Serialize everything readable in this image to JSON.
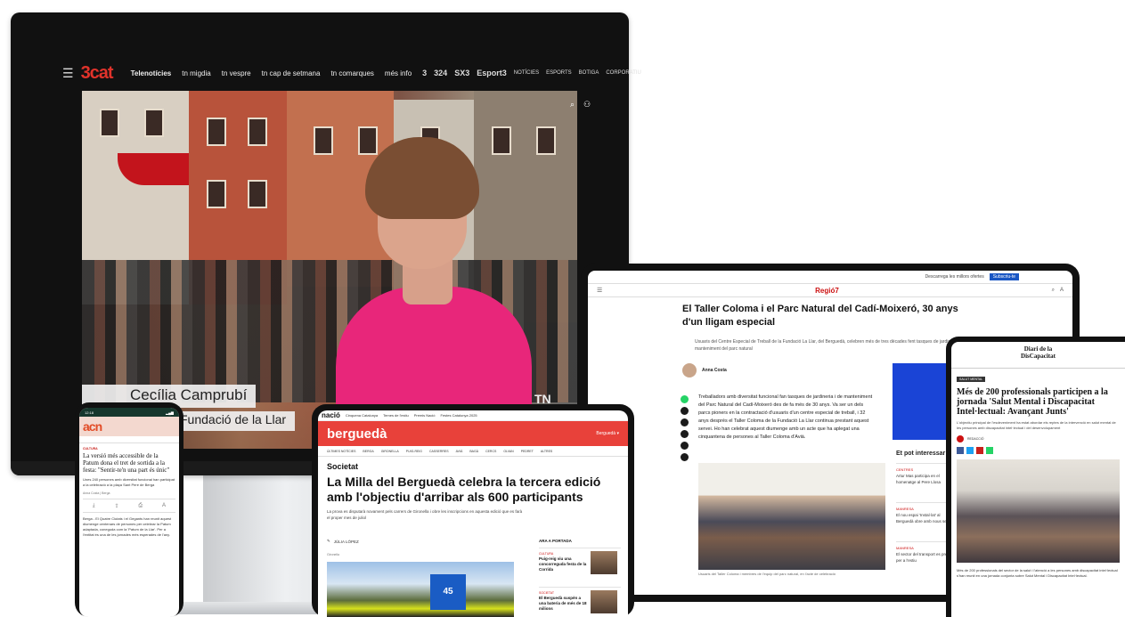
{
  "monitor": {
    "nav": {
      "logo": "3cat",
      "items": [
        "Telenotícies",
        "tn migdia",
        "tn vespre",
        "tn cap de setmana",
        "tn comarques",
        "més info"
      ],
      "right_channels": [
        "3",
        "324",
        "SX3",
        "Esport3"
      ],
      "right_links": [
        "NOTÍCIES",
        "ESPORTS",
        "BOTIGA",
        "CORPORATIU"
      ]
    },
    "video": {
      "name": "Cecília Camprubí",
      "org": "Fundació de la Llar",
      "bug": "TN"
    }
  },
  "regio7": {
    "topbar_text": "Descarrega les millors ofertes",
    "subscribe": "Subscriu-te",
    "logo": "Regió7",
    "title": "El Taller Coloma i el Parc Natural del Cadí-Moixeró, 30 anys d'un lligam especial",
    "lead": "Usuaris del Centre Especial de Treball de la Fundació La Llar, del Berguedà, celebren més de tres dècades fent tasques de jardineria i manteniment del parc natural",
    "author": "Anna Costa",
    "body": "Treballadors amb diversitat funcional fan tasques de jardineria i de manteniment del Parc Natural del Cadí-Moixeró des de fa més de 30 anys. Va ser un dels parcs pioners en la contractació d'usuaris d'un centre especial de treball, i 32 anys després el Taller Coloma de la Fundació La Llar continua prestant aquest servei. Ho han celebrat aquest diumenge amb un acte que ha aplegat una cinquantena de persones al Taller Coloma d'Avià.",
    "caption": "Usuaris del Taller Coloma i membres de l'equip del parc natural, en l'acte de celebració",
    "side_title": "Et pot interessar",
    "side_items": [
      {
        "tag": "CENTRES",
        "text": "Artur Mas participa en el homenatge al Pere Llosa"
      },
      {
        "tag": "MANRESA",
        "text": "El nou espai 'Instal·lat' al Berguedà obre amb nous serveis"
      },
      {
        "tag": "MANRESA",
        "text": "El sector del transport es prepara per a l'estiu"
      }
    ]
  },
  "diari": {
    "logo_line1": "Diari de la",
    "logo_line2": "DisCapacitat",
    "tag": "SALUT MENTAL",
    "title": "Més de 200 professionals participen a la jornada 'Salut Mental i Discapacitat Intel·lectual: Avançant Junts'",
    "lead": "L'objectiu principal de l'esdeveniment ha estat abordar els reptes de la intervenció en salut mental de les persones amb discapacitat intel·lectual i del desenvolupament",
    "author": "REDACCIÓ",
    "body": "Més de 200 professionals del sector de la salut i l'atenció a les persones amb discapacitat intel·lectual s'han reunit en una jornada conjunta sobre Salut Mental i Discapacitat Intel·lectual."
  },
  "acn": {
    "time": "12:18",
    "logo": "acn",
    "section": "CULTURA",
    "title": "La versió més accessible de la Patum dona el tret de sortida a la festa: \"Sentir-te'n una part és únic\"",
    "lead": "Unes 240 persones amb diversitat funcional han participat a la celebració a la plaça Sant Pere de Berga",
    "byline": "Anna Costa | Berga",
    "body": "Berga - El Quatre Ciutats i el Gegants han reunit aquest diumenge centenars de persones per celebrar la Patum adaptada, coneguda com la 'Patum de la Llar'. Per a l'entitat és una de les jornades més esperades de l'any."
  },
  "nacio": {
    "logo": "nació",
    "top_links": [
      "Cinquena Catalunya",
      "Temes de l'estiu",
      "Premis Nació",
      "Festes Catalunya 2025"
    ],
    "brand": "berguedà",
    "brand_right": "Berguedà ▾",
    "menu": [
      "ÚLTIMES NOTÍCIES",
      "BERGA",
      "GIRONELLA",
      "PUIG-REIG",
      "CASSERRES",
      "AVIÀ",
      "BAGÀ",
      "CERCS",
      "OLVAN",
      "PEDRET",
      "ALTRES"
    ],
    "section": "Societat",
    "title": "La Milla del Berguedà celebra la tercera edició amb l'objectiu d'arribar als 600 participants",
    "lead": "La prova es disputarà novament pels carrers de Gironella i obre les inscripcions en aquesta edició que es farà el proper mes de juliol",
    "author": "JÚLIA LÓPEZ",
    "date": "Gironella",
    "aside_title": "ARA A PORTADA",
    "aside_items": [
      {
        "tag": "CULTURA",
        "text": "Puig-reig viu una concorreguda festa de la Corrida"
      },
      {
        "tag": "SOCIETAT",
        "text": "El Berguedà suspèn a una bateria de més de 18 milions"
      }
    ],
    "photo_badge": "45"
  }
}
